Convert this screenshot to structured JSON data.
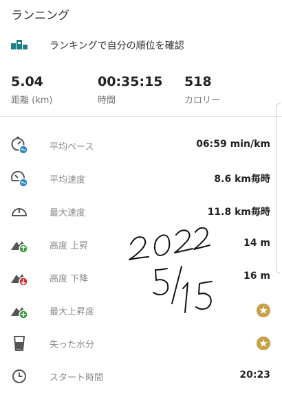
{
  "header": {
    "title": "ランニング"
  },
  "ranking": {
    "label": "ランキングで自分の順位を確認"
  },
  "stats": [
    {
      "value": "5.04",
      "label": "距離 (km)"
    },
    {
      "value": "00:35:15",
      "label": "時間"
    },
    {
      "value": "518",
      "label": "カロリー"
    }
  ],
  "rows": [
    {
      "label": "平均ペース",
      "value": "06:59 min/km"
    },
    {
      "label": "平均速度",
      "value": "8.6 km毎時"
    },
    {
      "label": "最大速度",
      "value": "11.8 km毎時"
    },
    {
      "label": "高度 上昇",
      "value": "14 m"
    },
    {
      "label": "高度 下降",
      "value": "16 m"
    },
    {
      "label": "最大上昇度",
      "value": ""
    },
    {
      "label": "失った水分",
      "value": ""
    },
    {
      "label": "スタート時間",
      "value": "20:23"
    }
  ],
  "handwriting": {
    "line1": "2022",
    "line2": "5/15"
  },
  "colors": {
    "teal": "#1b7f86",
    "blue": "#2e8bc9",
    "green": "#3a9b3a",
    "red": "#d03030",
    "gold": "#c8a04a",
    "icon_gray": "#555555"
  }
}
